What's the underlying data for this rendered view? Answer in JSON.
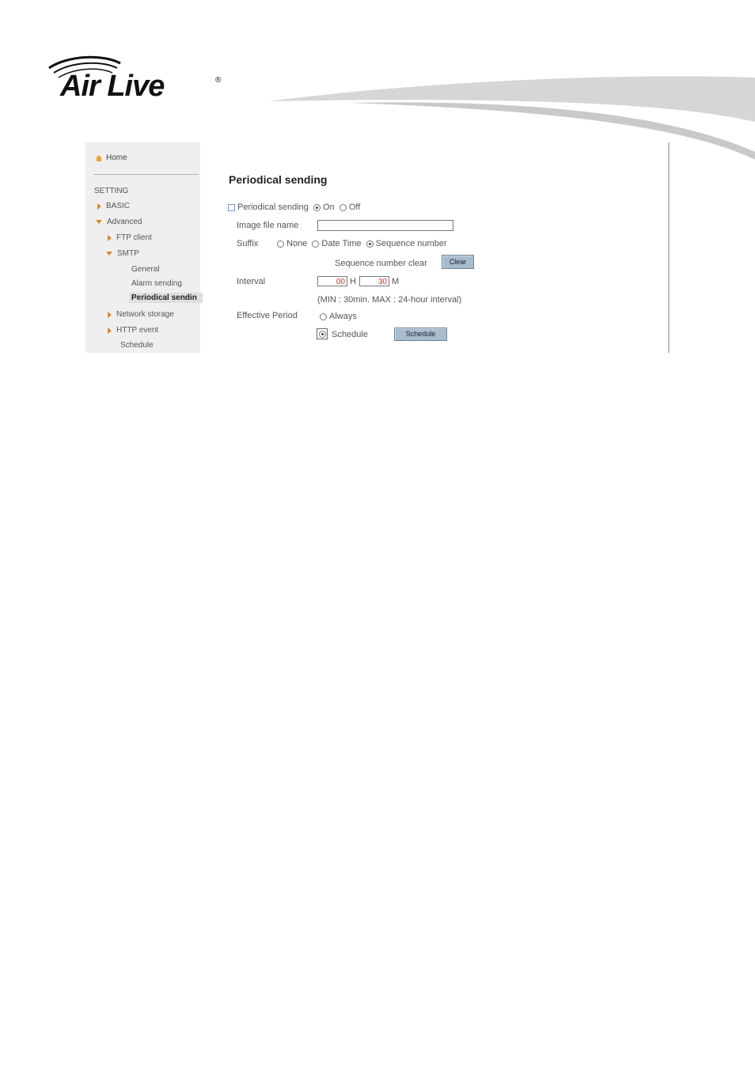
{
  "brand": {
    "name": "Air Live",
    "reg": "®"
  },
  "sidebar": {
    "home": "Home",
    "section": "SETTING",
    "items": [
      {
        "label": "BASIC"
      },
      {
        "label": "Advanced"
      },
      {
        "label": "FTP client"
      },
      {
        "label": "SMTP"
      },
      {
        "label": "General"
      },
      {
        "label": "Alarm sending"
      },
      {
        "label": "Periodical sendin"
      },
      {
        "label": "Network storage"
      },
      {
        "label": "HTTP event"
      },
      {
        "label": "Schedule"
      }
    ]
  },
  "form": {
    "title": "Periodical sending",
    "periodical": {
      "label": "Periodical sending",
      "on": "On",
      "off": "Off",
      "selected": "On"
    },
    "image_file_name": {
      "label": "Image file name",
      "value": ""
    },
    "suffix": {
      "label": "Suffix",
      "none": "None",
      "datetime": "Date Time",
      "sequence": "Sequence number",
      "selected": "Sequence number"
    },
    "seq_clear": {
      "label": "Sequence number clear",
      "button": "Clear"
    },
    "interval": {
      "label": "Interval",
      "hours": "00",
      "h_unit": "H",
      "minutes": "30",
      "m_unit": "M",
      "note": "(MIN : 30min. MAX : 24-hour interval)"
    },
    "effective": {
      "label": "Effective Period",
      "always": "Always",
      "schedule": "Schedule",
      "button": "Schedule",
      "selected": "Schedule"
    }
  },
  "colors": {
    "accent_triangle": "#d88a2a",
    "button_bg": "#a7bccd",
    "input_value": "#c0392b"
  }
}
